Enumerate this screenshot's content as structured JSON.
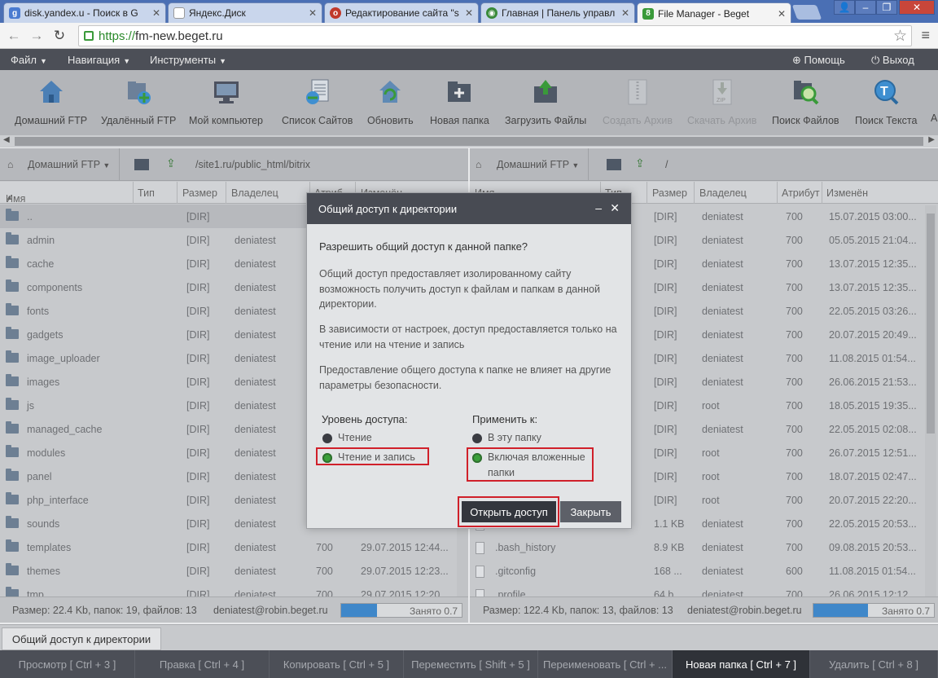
{
  "browser": {
    "tabs": [
      {
        "label": "disk.yandex.u - Поиск в G",
        "favicon": "google-icon",
        "color": "#4a7bd0"
      },
      {
        "label": "Яндекс.Диск",
        "favicon": "page-icon",
        "color": "#777777"
      },
      {
        "label": "Редактирование сайта \"s",
        "favicon": "opera-icon",
        "color": "#c0392b"
      },
      {
        "label": "Главная | Панель управл",
        "favicon": "eye-icon",
        "color": "#3a8a3a"
      },
      {
        "label": "File Manager - Beget",
        "favicon": "beget-icon",
        "color": "#3a9a3a"
      }
    ],
    "url_scheme": "https://",
    "url_host": "fm-new.beget.ru"
  },
  "app_menu": {
    "items": [
      "Файл",
      "Навигация",
      "Инструменты"
    ],
    "help": "Помощь",
    "logout": "Выход"
  },
  "toolbar": {
    "tools": [
      {
        "label": "Домашний FTP",
        "icon": "home-icon",
        "enabled": true
      },
      {
        "label": "Удалённый FTP",
        "icon": "remote-ftp-icon",
        "enabled": true
      },
      {
        "label": "Мой компьютер",
        "icon": "computer-icon",
        "enabled": true
      },
      {
        "label": "Список Сайтов",
        "icon": "sites-list-icon",
        "enabled": true
      },
      {
        "label": "Обновить",
        "icon": "refresh-icon",
        "enabled": true
      },
      {
        "label": "Новая папка",
        "icon": "new-folder-icon",
        "enabled": true
      },
      {
        "label": "Загрузить Файлы",
        "icon": "upload-icon",
        "enabled": true
      },
      {
        "label": "Создать Архив",
        "icon": "archive-icon",
        "enabled": false
      },
      {
        "label": "Скачать Архив",
        "icon": "download-zip-icon",
        "enabled": false
      },
      {
        "label": "Поиск Файлов",
        "icon": "search-files-icon",
        "enabled": true
      },
      {
        "label": "Поиск Текста",
        "icon": "search-text-icon",
        "enabled": true
      },
      {
        "label": "Ар",
        "icon": "",
        "enabled": true
      }
    ]
  },
  "left_panel": {
    "location": "Домашний FTP",
    "path": "/site1.ru/public_html/bitrix",
    "columns": [
      "Имя",
      "Тип",
      "Размер",
      "Владелец",
      "Атриб",
      "Изменён"
    ],
    "rows": [
      {
        "name": "..",
        "size": "[DIR]",
        "owner": "",
        "attr": "",
        "modified": ""
      },
      {
        "name": "admin",
        "size": "[DIR]",
        "owner": "deniatest",
        "attr": "",
        "modified": ""
      },
      {
        "name": "cache",
        "size": "[DIR]",
        "owner": "deniatest",
        "attr": "",
        "modified": ""
      },
      {
        "name": "components",
        "size": "[DIR]",
        "owner": "deniatest",
        "attr": "",
        "modified": ""
      },
      {
        "name": "fonts",
        "size": "[DIR]",
        "owner": "deniatest",
        "attr": "",
        "modified": ""
      },
      {
        "name": "gadgets",
        "size": "[DIR]",
        "owner": "deniatest",
        "attr": "",
        "modified": ""
      },
      {
        "name": "image_uploader",
        "size": "[DIR]",
        "owner": "deniatest",
        "attr": "",
        "modified": ""
      },
      {
        "name": "images",
        "size": "[DIR]",
        "owner": "deniatest",
        "attr": "",
        "modified": ""
      },
      {
        "name": "js",
        "size": "[DIR]",
        "owner": "deniatest",
        "attr": "",
        "modified": ""
      },
      {
        "name": "managed_cache",
        "size": "[DIR]",
        "owner": "deniatest",
        "attr": "",
        "modified": ""
      },
      {
        "name": "modules",
        "size": "[DIR]",
        "owner": "deniatest",
        "attr": "",
        "modified": ""
      },
      {
        "name": "panel",
        "size": "[DIR]",
        "owner": "deniatest",
        "attr": "",
        "modified": ""
      },
      {
        "name": "php_interface",
        "size": "[DIR]",
        "owner": "deniatest",
        "attr": "",
        "modified": ""
      },
      {
        "name": "sounds",
        "size": "[DIR]",
        "owner": "deniatest",
        "attr": "",
        "modified": ""
      },
      {
        "name": "templates",
        "size": "[DIR]",
        "owner": "deniatest",
        "attr": "700",
        "modified": "29.07.2015 12:44..."
      },
      {
        "name": "themes",
        "size": "[DIR]",
        "owner": "deniatest",
        "attr": "700",
        "modified": "29.07.2015 12:23..."
      },
      {
        "name": "tmp",
        "size": "[DIR]",
        "owner": "deniatest",
        "attr": "700",
        "modified": "29.07.2015 12:20..."
      }
    ],
    "status": "Размер: 22.4 Kb, папок: 19, файлов: 13",
    "account": "deniatest@robin.beget.ru",
    "usage_label": "Занято 0.7",
    "usage_fraction": 0.3
  },
  "right_panel": {
    "location": "Домашний FTP",
    "path": "/",
    "columns": [
      "Имя",
      "Тип",
      "Размер",
      "Владелец",
      "Атрибут",
      "Изменён"
    ],
    "rows": [
      {
        "name": "",
        "size": "[DIR]",
        "owner": "deniatest",
        "attr": "700",
        "modified": "15.07.2015 03:00..."
      },
      {
        "name": "",
        "size": "[DIR]",
        "owner": "deniatest",
        "attr": "700",
        "modified": "05.05.2015 21:04..."
      },
      {
        "name": "",
        "size": "[DIR]",
        "owner": "deniatest",
        "attr": "700",
        "modified": "13.07.2015 12:35..."
      },
      {
        "name": "",
        "size": "[DIR]",
        "owner": "deniatest",
        "attr": "700",
        "modified": "13.07.2015 12:35..."
      },
      {
        "name": "",
        "size": "[DIR]",
        "owner": "deniatest",
        "attr": "700",
        "modified": "22.05.2015 03:26..."
      },
      {
        "name": "",
        "size": "[DIR]",
        "owner": "deniatest",
        "attr": "700",
        "modified": "20.07.2015 20:49..."
      },
      {
        "name": "",
        "size": "[DIR]",
        "owner": "deniatest",
        "attr": "700",
        "modified": "11.08.2015 01:54..."
      },
      {
        "name": "",
        "size": "[DIR]",
        "owner": "deniatest",
        "attr": "700",
        "modified": "26.06.2015 21:53..."
      },
      {
        "name": "",
        "size": "[DIR]",
        "owner": "root",
        "attr": "700",
        "modified": "18.05.2015 19:35..."
      },
      {
        "name": "",
        "size": "[DIR]",
        "owner": "deniatest",
        "attr": "700",
        "modified": "22.05.2015 02:08..."
      },
      {
        "name": "",
        "size": "[DIR]",
        "owner": "root",
        "attr": "700",
        "modified": "26.07.2015 12:51..."
      },
      {
        "name": "",
        "size": "[DIR]",
        "owner": "root",
        "attr": "700",
        "modified": "18.07.2015 02:47..."
      },
      {
        "name": "",
        "size": "[DIR]",
        "owner": "root",
        "attr": "700",
        "modified": "20.07.2015 22:20..."
      },
      {
        "name": "",
        "size": "1.1 KB",
        "owner": "deniatest",
        "attr": "700",
        "modified": "22.05.2015 20:53..."
      },
      {
        "name": ".bash_history",
        "size": "8.9 KB",
        "owner": "deniatest",
        "attr": "700",
        "modified": "09.08.2015 20:53..."
      },
      {
        "name": ".gitconfig",
        "size": "168 ...",
        "owner": "deniatest",
        "attr": "600",
        "modified": "11.08.2015 01:54..."
      },
      {
        "name": ".profile",
        "size": "64 b",
        "owner": "deniatest",
        "attr": "700",
        "modified": "26.06.2015 12:12..."
      }
    ],
    "status": "Размер: 122.4 Kb, папок: 13, файлов: 13",
    "account": "deniatest@robin.beget.ru",
    "usage_label": "Занято 0.7",
    "usage_fraction": 0.45
  },
  "dialog": {
    "title": "Общий доступ к директории",
    "question": "Разрешить общий доступ к данной папке?",
    "para1": "Общий доступ предоставляет изолированному сайту возможность получить доступ к файлам и папкам в данной директории.",
    "para2": "В зависимости от настроек, доступ предоставляется только на чтение или на чтение и запись",
    "para3": "Предоставление общего доступа к папке не влияет на другие параметры безопасности.",
    "access_level_label": "Уровень доступа:",
    "access_read": "Чтение",
    "access_read_write": "Чтение и запись",
    "apply_to_label": "Применить к:",
    "apply_this": "В эту папку",
    "apply_including_line1": "Включая вложенные",
    "apply_including_line2": "папки",
    "open_button": "Открыть доступ",
    "close_button": "Закрыть"
  },
  "taskbar": {
    "task": "Общий доступ к директории"
  },
  "hotkeys": [
    {
      "label": "Просмотр [ Ctrl + 3 ]",
      "active": false
    },
    {
      "label": "Правка [ Ctrl + 4 ]",
      "active": false
    },
    {
      "label": "Копировать [ Ctrl + 5 ]",
      "active": false
    },
    {
      "label": "Переместить [ Shift + 5 ]",
      "active": false
    },
    {
      "label": "Переименовать [ Ctrl + ...",
      "active": false
    },
    {
      "label": "Новая папка [ Ctrl + 7 ]",
      "active": true
    },
    {
      "label": "Удалить [ Ctrl + 8 ]",
      "active": false
    }
  ]
}
